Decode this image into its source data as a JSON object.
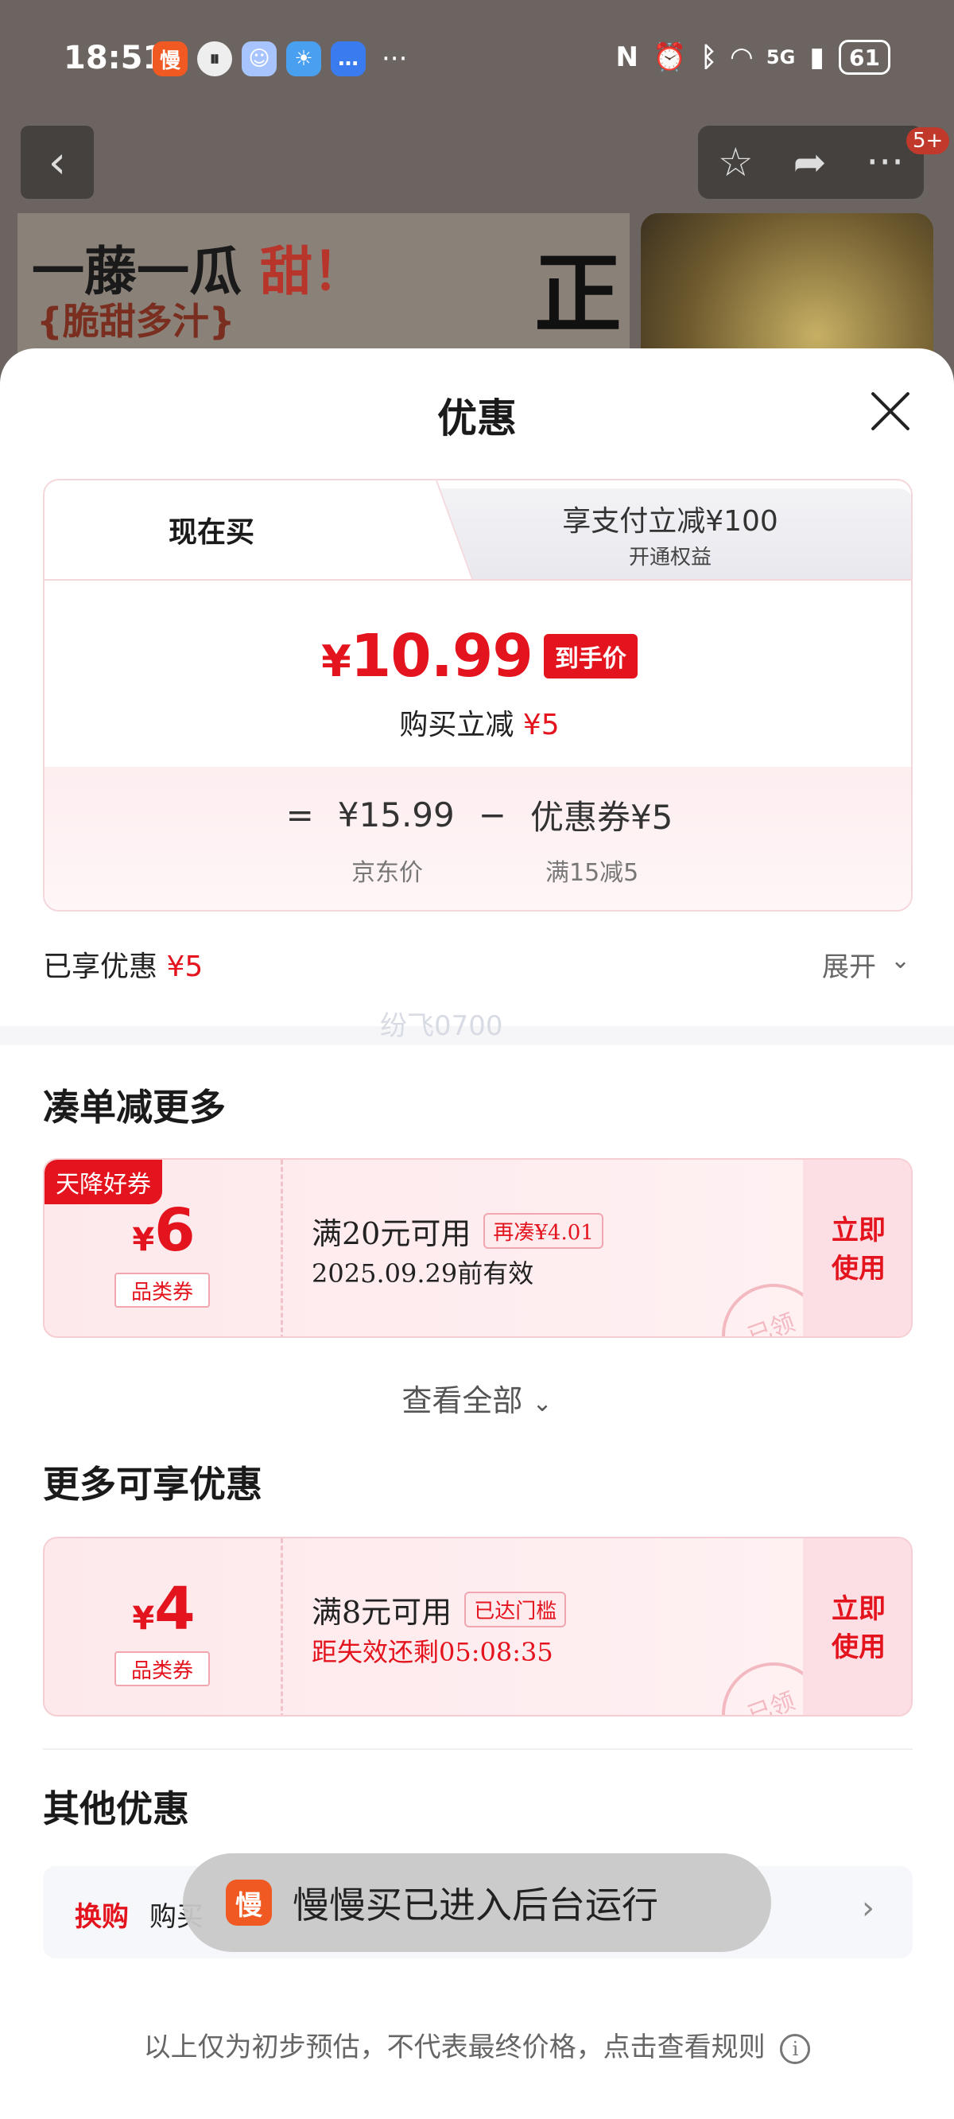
{
  "status_bar": {
    "time": "18:51",
    "app_icons": [
      "慢",
      "⏸",
      "☺",
      "☀",
      "…"
    ],
    "more": "···",
    "network": "5G",
    "battery": "61"
  },
  "background": {
    "banner_title_a": "一藤一瓜",
    "banner_title_b": "甜！",
    "banner_sub": "{脆甜多汁}",
    "banner_char": "正",
    "badge": "5+"
  },
  "sheet": {
    "title": "优惠",
    "tabs": {
      "now": "现在买",
      "pay_title": "享支付立减¥100",
      "pay_sub": "开通权益"
    },
    "final_price": {
      "currency": "¥",
      "amount": "10.99",
      "tag": "到手价"
    },
    "buy_reduce": {
      "label": "购买立减",
      "value": "¥5"
    },
    "formula": {
      "eq": "=",
      "jd_price": "¥15.99",
      "minus": "−",
      "coupon": "优惠券¥5",
      "jd_label": "京东价",
      "coupon_label": "满15减5"
    },
    "enjoyed": {
      "label": "已享优惠",
      "value": "¥5"
    },
    "expand": "展开",
    "watermark": "纷飞0700"
  },
  "section_combine": {
    "title": "凑单减更多",
    "coupon": {
      "badge": "天降好券",
      "currency": "¥",
      "amount": "6",
      "type": "品类券",
      "condition": "满20元可用",
      "tag": "再凑¥4.01",
      "validity": "2025.09.29前有效",
      "action": "立即使用",
      "stamp": "已领"
    },
    "view_all": "查看全部"
  },
  "section_more": {
    "title": "更多可享优惠",
    "coupon": {
      "currency": "¥",
      "amount": "4",
      "type": "品类券",
      "condition": "满8元可用",
      "tag": "已达门槛",
      "validity": "距失效还剩05:08:35",
      "action": "立即使用",
      "stamp": "已领"
    }
  },
  "section_other": {
    "title": "其他优惠",
    "row_tag": "换购",
    "row_text": "购买"
  },
  "toast": {
    "icon": "慢",
    "text": "慢慢买已进入后台运行"
  },
  "footer": {
    "note": "以上仅为初步预估，不代表最终价格，点击查看规则"
  },
  "colors": {
    "accent": "#e4141e",
    "pink_bg": "#fde9ec"
  }
}
